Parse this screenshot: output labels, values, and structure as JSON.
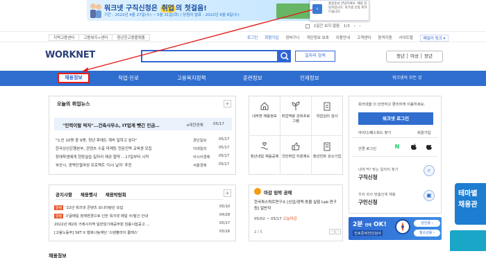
{
  "banner": {
    "title_pre": "워크넷 구직신청은",
    "title_hl": "취업",
    "title_post": "의 첫걸음!",
    "subtitle": "기간 : 2022년 4월 27일(수) ~ 5월 31일(화) / 당첨자 발표 : 2022년 6월 8일(수)",
    "popup_text": "홈길동님 반녕하세요. 채용 당당자입니다. 워크넷 신청 축하드립니다."
  },
  "pager": {
    "today_label": "1일간 보지 않음",
    "count": "1/3"
  },
  "util_left": [
    "지역고용센터",
    "고용복지+센터",
    "청년친고용플랫폼"
  ],
  "util_right": [
    "로그인",
    "회원가입",
    "장바구니",
    "개인정보 보호",
    "이용안내",
    "고객센터",
    "원격지원",
    "사이트맵"
  ],
  "util_right_lang": "패밀리 링크 ▾",
  "header": {
    "logo": "WORKNET",
    "search_placeholder": "",
    "job_search_btn": "일자리 검색",
    "user_type": "청년 │ 여성 │ 장년"
  },
  "nav": {
    "items": [
      "채용정보",
      "직업·진로",
      "고용복지정책",
      "훈련정보",
      "인재정보"
    ],
    "right": "워크넷의 모든 것"
  },
  "news": {
    "title": "오늘의 취업뉴스",
    "plus": "+",
    "feature": {
      "text": "\"인력이탈 막자\"…건축사무소, IT업계 뺏긴 인금…",
      "src": "e대한경제",
      "date": "05/17"
    },
    "rows": [
      {
        "text": "\"노인 10명 중 9명, 정년 후에도 계속 일하고 싶다\"",
        "src": "경인일보",
        "date": "05/17"
      },
      {
        "text": "한국상선은행본부, 콘텐츠 수출 마케팅 전문인력 교육생 모집",
        "src": "이데일리",
        "date": "05/17"
      },
      {
        "text": "장애학생에게 현장실습·일자리 제공 협약 …17일부터 시작",
        "src": "아시아경제",
        "date": "05/17"
      },
      {
        "text": "부산시, 경력단절여성 프로젝트 '다시 날자' 추진",
        "src": "서울경제",
        "date": "05/17"
      }
    ]
  },
  "notice": {
    "tabs": [
      "공지사항",
      "채용행사",
      "채용박람회"
    ],
    "plus": "+",
    "tag_label": "알림",
    "rows": [
      {
        "tag": true,
        "text": "'22년 워크넷 콘텐츠 모니터링단 모집",
        "date": "05/10"
      },
      {
        "tag": true,
        "text": "구글메일 정책변경으로 인한 워크넷 메일 수/발신 안내",
        "date": "04/28"
      },
      {
        "tag": false,
        "text": "2022년 제2회 거제시지역 일반임기제공무원 임용시험공고 …",
        "date": "05/17"
      },
      {
        "tag": false,
        "text": "[고용노동부] SKT X 행복나눔재단 '스텐블라이 클래스'",
        "date": "05/16"
      }
    ]
  },
  "icon_grid": [
    {
      "icon": "house-icon",
      "label": "내주변 채용정보"
    },
    {
      "icon": "plant-icon",
      "label": "취업역량 강화프로그램"
    },
    {
      "icon": "clipboard-icon",
      "label": "직업심리 검사"
    },
    {
      "icon": "hand-heart-icon",
      "label": "청년내일 채움공제"
    },
    {
      "icon": "thumb-up-icon",
      "label": "국민취업 지원제도"
    },
    {
      "icon": "building-icon",
      "label": "청년친화 강소기업"
    }
  ],
  "deadline": {
    "title": "마감 임박 공채",
    "text": "한국파스퇴르연구소 [신입/경력·동물 실험 Lab 연구원] 일반직",
    "date": "05/02 ~ 05/17",
    "date_status": "오늘마감",
    "page": "2 / 5",
    "prev": "‹",
    "next": "›"
  },
  "login": {
    "info": "워크넷을 더 안전하고 편리하게 이용하세요.",
    "button": "워크넷 로그인",
    "find": "아이디/패스워드 찾기",
    "signup": "회원가입",
    "simple": "간편 로그인",
    "naver": "N",
    "apple": "",
    "kakao": "",
    "register1_sub": "내게 딱! 맞는 일자리 찾기",
    "register1_title": "구직신청",
    "register2_sub": "우리 회사 맞춤인재 채용",
    "register2_title": "구인신청"
  },
  "ad": {
    "main": "2분",
    "main_small": "만에",
    "main2": "OK!",
    "sub": "진로준비진단검사",
    "pill1": "성인용 ›",
    "pill2": "청소년용 ›"
  },
  "floater": {
    "line1": "테마별",
    "line2": "채용관"
  },
  "bottom": {
    "title": "채용정보"
  }
}
